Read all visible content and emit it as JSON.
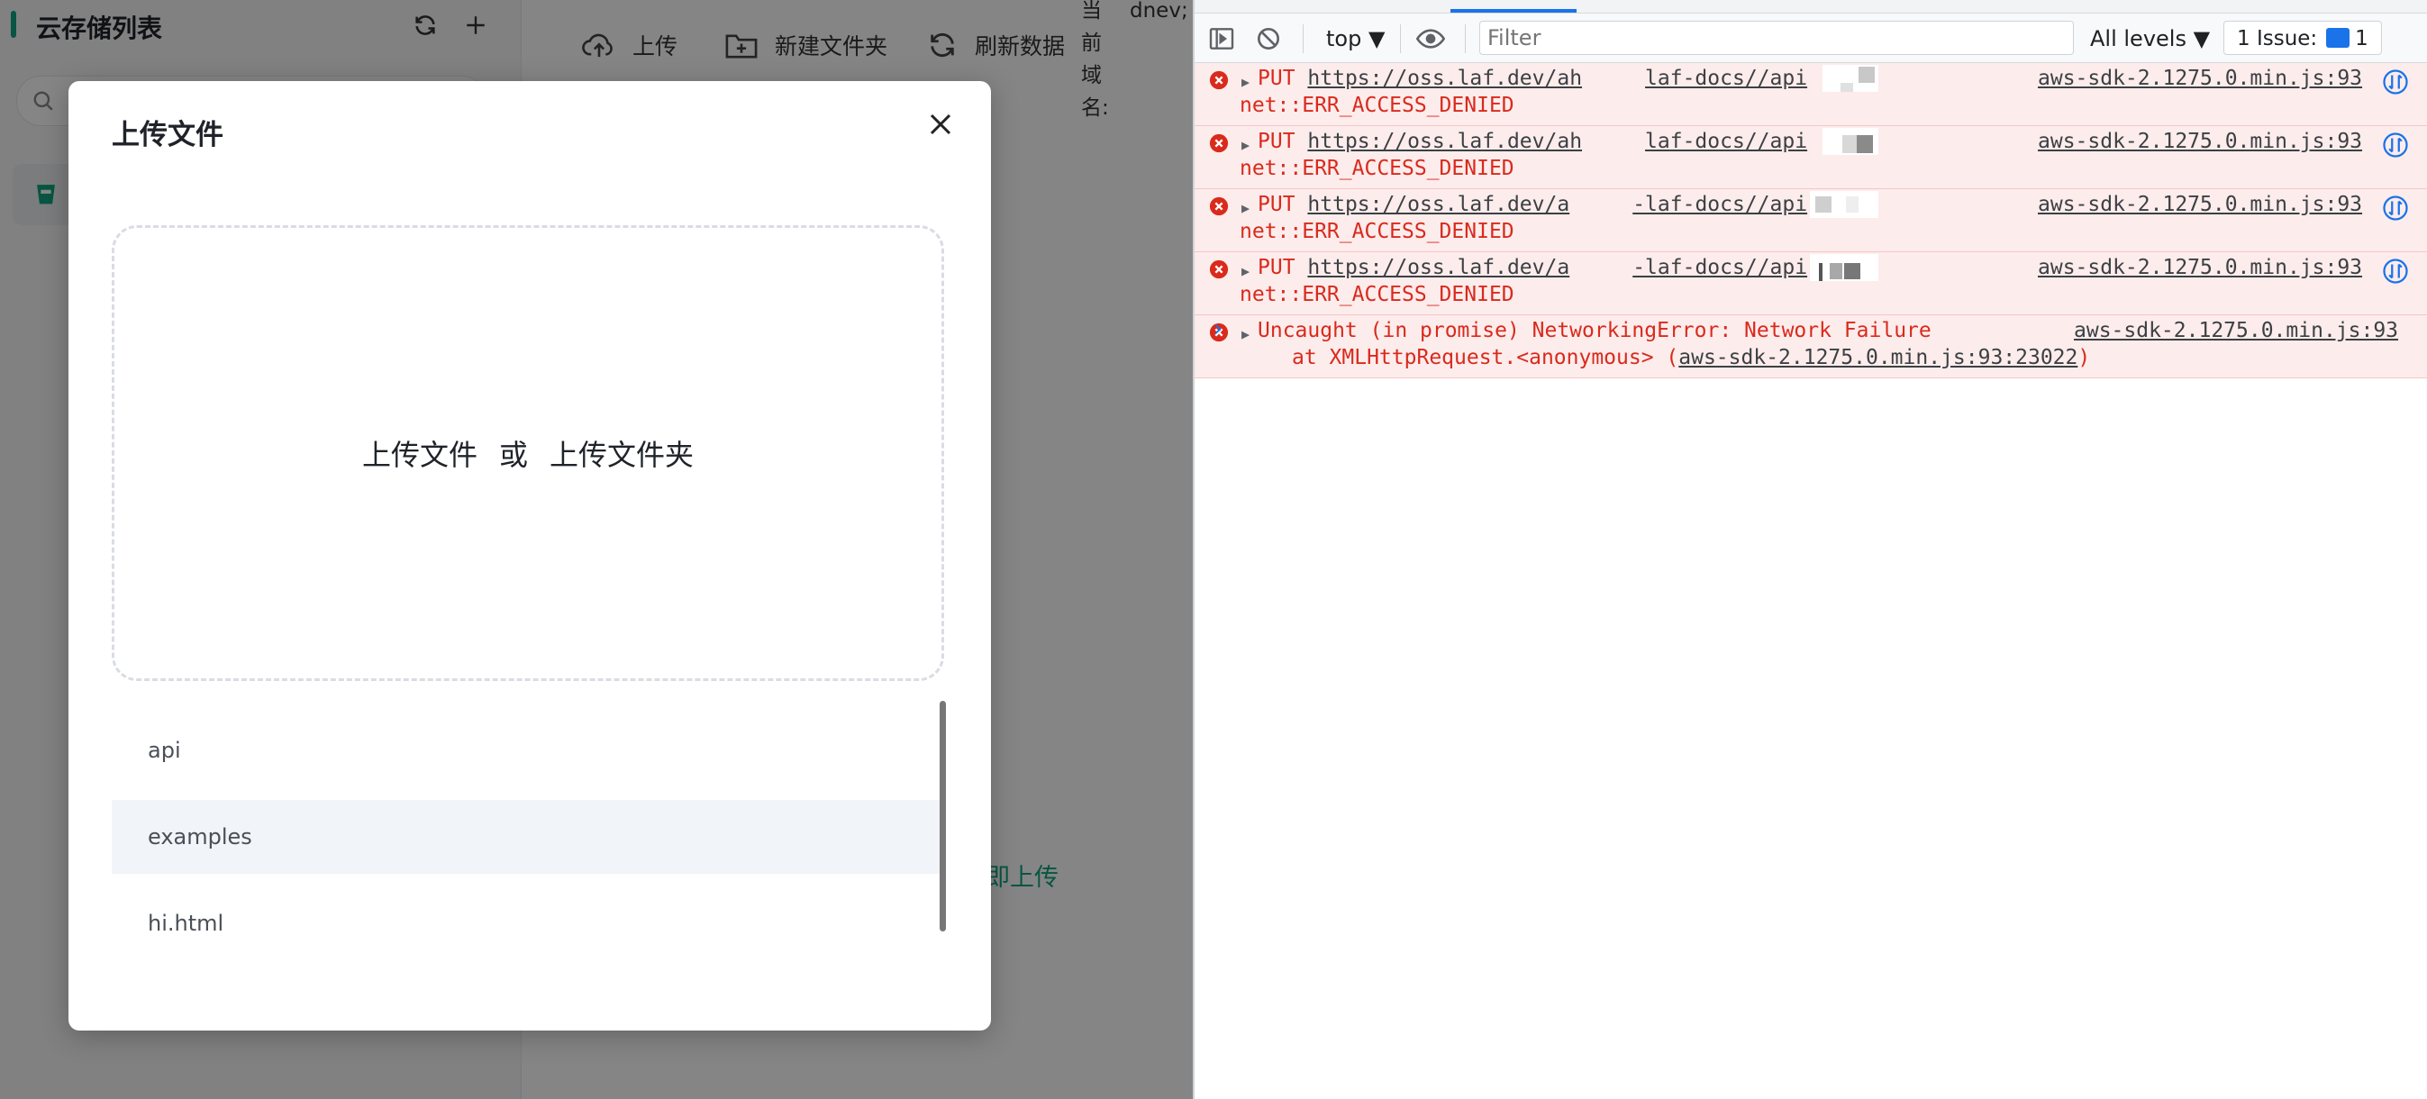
{
  "sidebar": {
    "title": "云存储列表"
  },
  "toolbar": {
    "upload_label": "上传",
    "new_folder_label": "新建文件夹",
    "refresh_label": "刷新数据"
  },
  "domain": {
    "label": "当前域名:",
    "value": "dnev; docs."
  },
  "main": {
    "upload_now": "即上传"
  },
  "modal": {
    "title": "上传文件",
    "upload_file": "上传文件",
    "or": "或",
    "upload_folder": "上传文件夹",
    "files": [
      "api",
      "examples",
      "hi.html"
    ]
  },
  "devtools": {
    "context": "top",
    "filter_placeholder": "Filter",
    "levels": "All levels",
    "issues_label": "1 Issue:",
    "issues_count": "1",
    "logs": [
      {
        "method": "PUT",
        "url_start": "https://oss.laf.dev/ah",
        "url_end": "laf-docs//api",
        "error": "net::ERR_ACCESS_DENIED",
        "source": "aws-sdk-2.1275.0.min.js:93"
      },
      {
        "method": "PUT",
        "url_start": "https://oss.laf.dev/ah",
        "url_end": "laf-docs//api",
        "error": "net::ERR_ACCESS_DENIED",
        "source": "aws-sdk-2.1275.0.min.js:93"
      },
      {
        "method": "PUT",
        "url_start": "https://oss.laf.dev/a",
        "url_end": "-laf-docs//api",
        "error": "net::ERR_ACCESS_DENIED",
        "source": "aws-sdk-2.1275.0.min.js:93"
      },
      {
        "method": "PUT",
        "url_start": "https://oss.laf.dev/a",
        "url_end": "-laf-docs//api",
        "error": "net::ERR_ACCESS_DENIED",
        "source": "aws-sdk-2.1275.0.min.js:93"
      }
    ],
    "exception": {
      "message": "Uncaught (in promise) NetworkingError: Network Failure",
      "stack_prefix": "at XMLHttpRequest.<anonymous> (",
      "stack_link": "aws-sdk-2.1275.0.min.js:93:23022",
      "stack_suffix": ")",
      "source": "aws-sdk-2.1275.0.min.js:93"
    },
    "prompt": "›"
  }
}
